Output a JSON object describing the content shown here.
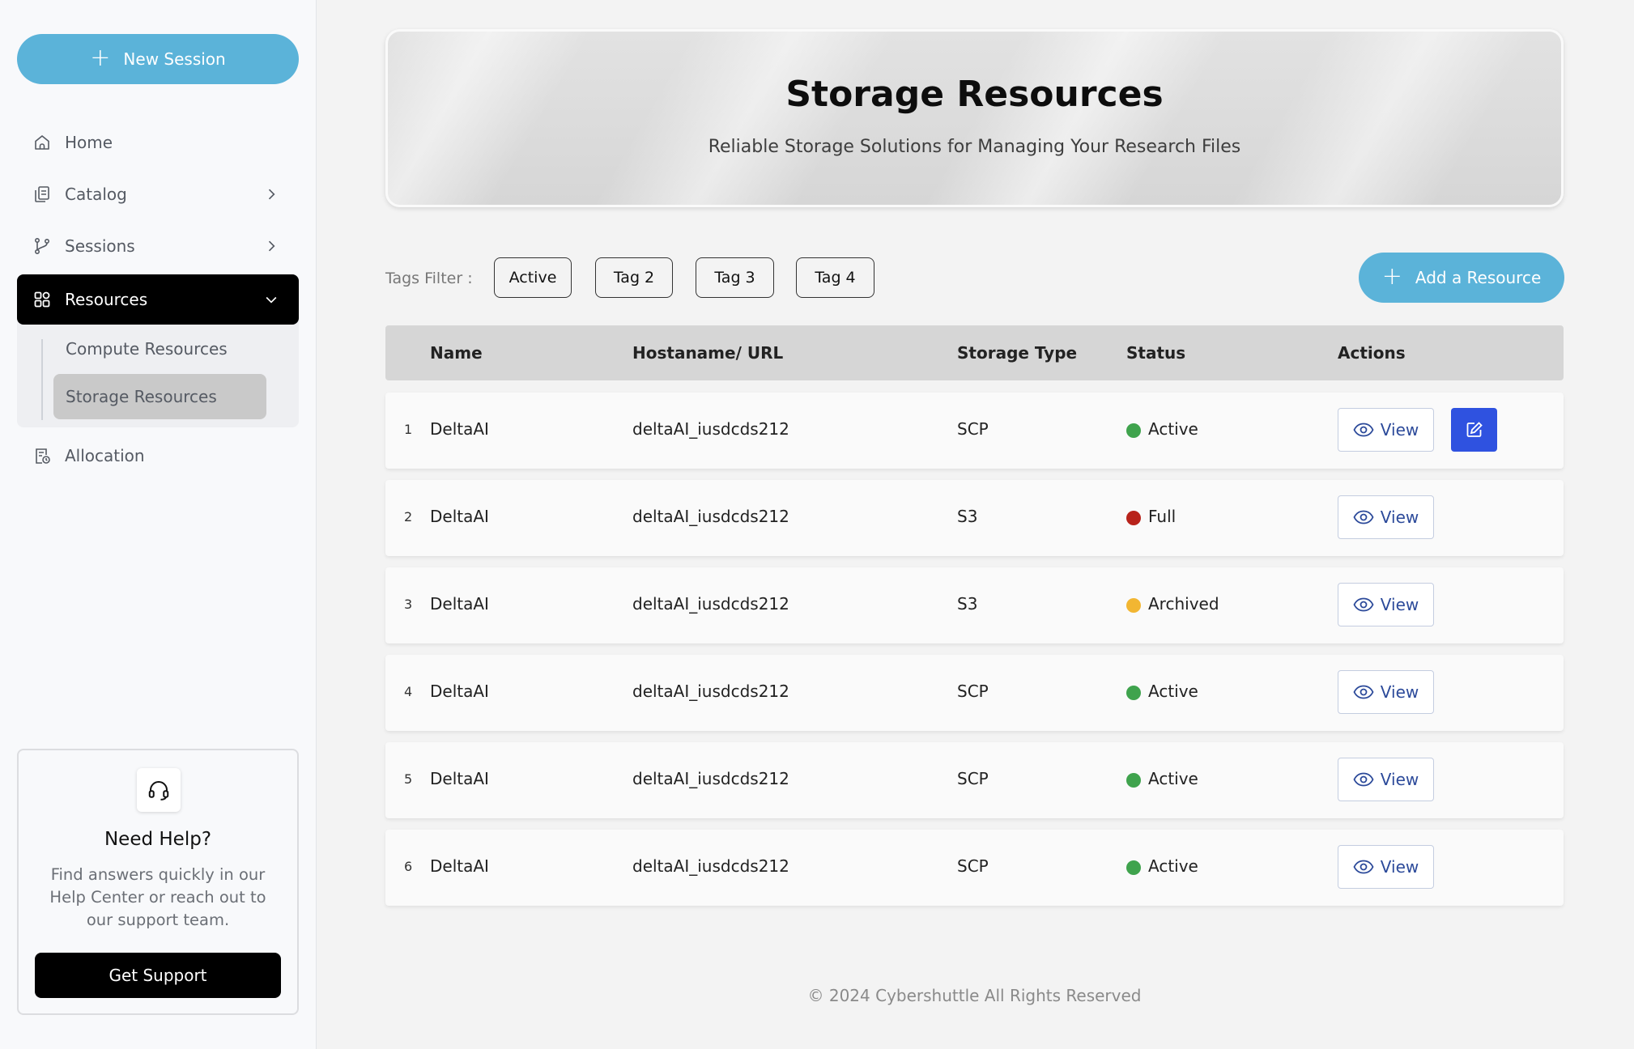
{
  "sidebar": {
    "new_session_label": "New Session",
    "nav": {
      "home": "Home",
      "catalog": "Catalog",
      "sessions": "Sessions",
      "resources": "Resources",
      "allocation": "Allocation"
    },
    "resources_sub": {
      "compute": "Compute Resources",
      "storage": "Storage Resources"
    },
    "help": {
      "title": "Need Help?",
      "text": "Find answers quickly in our Help Center or reach out to our support team.",
      "button": "Get Support"
    }
  },
  "hero": {
    "title": "Storage Resources",
    "subtitle": "Reliable Storage Solutions for Managing Your Research Files"
  },
  "filters": {
    "label": "Tags Filter :",
    "tags": [
      "Active",
      "Tag 2",
      "Tag 3",
      "Tag 4"
    ]
  },
  "add_resource_label": "Add a Resource",
  "table": {
    "headers": {
      "name": "Name",
      "host": "Hostaname/ URL",
      "type": "Storage Type",
      "status": "Status",
      "actions": "Actions"
    },
    "view_label": "View",
    "rows": [
      {
        "num": "1",
        "name": "DeltaAI",
        "host": "deltaAI_iusdcds212",
        "type": "SCP",
        "status": "Active",
        "status_color": "#3fa34d",
        "editable": true
      },
      {
        "num": "2",
        "name": "DeltaAI",
        "host": "deltaAI_iusdcds212",
        "type": "S3",
        "status": "Full",
        "status_color": "#b8231b",
        "editable": false
      },
      {
        "num": "3",
        "name": "DeltaAI",
        "host": "deltaAI_iusdcds212",
        "type": "S3",
        "status": "Archived",
        "status_color": "#f2b632",
        "editable": false
      },
      {
        "num": "4",
        "name": "DeltaAI",
        "host": "deltaAI_iusdcds212",
        "type": "SCP",
        "status": "Active",
        "status_color": "#3fa34d",
        "editable": false
      },
      {
        "num": "5",
        "name": "DeltaAI",
        "host": "deltaAI_iusdcds212",
        "type": "SCP",
        "status": "Active",
        "status_color": "#3fa34d",
        "editable": false
      },
      {
        "num": "6",
        "name": "DeltaAI",
        "host": "deltaAI_iusdcds212",
        "type": "SCP",
        "status": "Active",
        "status_color": "#3fa34d",
        "editable": false
      }
    ]
  },
  "footer": "© 2024 Cybershuttle All Rights Reserved",
  "colors": {
    "accent": "#5bb3d9",
    "edit_button": "#2f52e0",
    "view_text": "#2c4a9a"
  }
}
